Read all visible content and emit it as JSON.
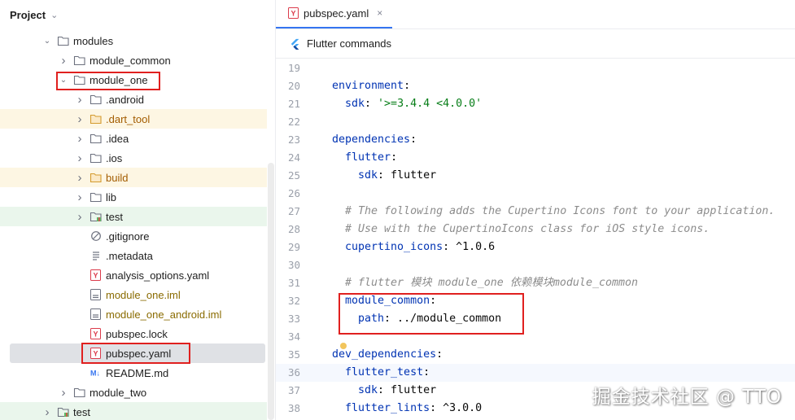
{
  "project": {
    "title": "Project",
    "tree": [
      {
        "label": "modules",
        "type": "folder",
        "expanded": true
      },
      {
        "label": "module_common",
        "type": "folder",
        "expanded": false
      },
      {
        "label": "module_one",
        "type": "folder",
        "expanded": true
      },
      {
        "label": ".android",
        "type": "folder",
        "expanded": false
      },
      {
        "label": ".dart_tool",
        "type": "folder-excluded",
        "expanded": false
      },
      {
        "label": ".idea",
        "type": "folder",
        "expanded": false
      },
      {
        "label": ".ios",
        "type": "folder",
        "expanded": false
      },
      {
        "label": "build",
        "type": "folder-excluded",
        "expanded": false
      },
      {
        "label": "lib",
        "type": "folder",
        "expanded": false
      },
      {
        "label": "test",
        "type": "folder-test",
        "expanded": false
      },
      {
        "label": ".gitignore",
        "type": "ignore-file"
      },
      {
        "label": ".metadata",
        "type": "text-file"
      },
      {
        "label": "analysis_options.yaml",
        "type": "yaml-file"
      },
      {
        "label": "module_one.iml",
        "type": "iml-file"
      },
      {
        "label": "module_one_android.iml",
        "type": "iml-file"
      },
      {
        "label": "pubspec.lock",
        "type": "yaml-file"
      },
      {
        "label": "pubspec.yaml",
        "type": "yaml-file",
        "selected": true
      },
      {
        "label": "README.md",
        "type": "markdown-file"
      },
      {
        "label": "module_two",
        "type": "folder",
        "expanded": false
      },
      {
        "label": "test",
        "type": "folder-test",
        "expanded": false
      }
    ]
  },
  "editor": {
    "tab_label": "pubspec.yaml",
    "tab_close": "×",
    "flutter_commands_label": "Flutter commands",
    "lines": [
      {
        "n": "19",
        "parts": []
      },
      {
        "n": "20",
        "parts": [
          {
            "t": "environment",
            "c": "key"
          },
          {
            "t": ":",
            "c": "plain"
          }
        ]
      },
      {
        "n": "21",
        "parts": [
          {
            "t": "  sdk",
            "c": "key"
          },
          {
            "t": ": ",
            "c": "plain"
          },
          {
            "t": "'>=3.4.4 <4.0.0'",
            "c": "str"
          }
        ]
      },
      {
        "n": "22",
        "parts": []
      },
      {
        "n": "23",
        "parts": [
          {
            "t": "dependencies",
            "c": "key"
          },
          {
            "t": ":",
            "c": "plain"
          }
        ]
      },
      {
        "n": "24",
        "parts": [
          {
            "t": "  flutter",
            "c": "key"
          },
          {
            "t": ":",
            "c": "plain"
          }
        ]
      },
      {
        "n": "25",
        "parts": [
          {
            "t": "    sdk",
            "c": "key"
          },
          {
            "t": ": flutter",
            "c": "plain"
          }
        ]
      },
      {
        "n": "26",
        "parts": []
      },
      {
        "n": "27",
        "parts": [
          {
            "t": "  # The following adds the Cupertino Icons font to your application.",
            "c": "cmt"
          }
        ]
      },
      {
        "n": "28",
        "parts": [
          {
            "t": "  # Use with the CupertinoIcons class for iOS style icons.",
            "c": "cmt"
          }
        ]
      },
      {
        "n": "29",
        "parts": [
          {
            "t": "  cupertino_icons",
            "c": "key"
          },
          {
            "t": ": ^1.0.6",
            "c": "plain"
          }
        ]
      },
      {
        "n": "30",
        "parts": []
      },
      {
        "n": "31",
        "parts": [
          {
            "t": "  # flutter 模块 module_one 依赖模块module_common",
            "c": "cmt"
          }
        ]
      },
      {
        "n": "32",
        "parts": [
          {
            "t": "  module_common",
            "c": "key"
          },
          {
            "t": ":",
            "c": "plain"
          }
        ]
      },
      {
        "n": "33",
        "parts": [
          {
            "t": "    path",
            "c": "key"
          },
          {
            "t": ": ../module_common",
            "c": "plain"
          }
        ]
      },
      {
        "n": "34",
        "parts": []
      },
      {
        "n": "35",
        "parts": [
          {
            "t": "dev_dependencies",
            "c": "key"
          },
          {
            "t": ":",
            "c": "plain"
          }
        ]
      },
      {
        "n": "36",
        "parts": [
          {
            "t": "  flutter_test",
            "c": "key"
          },
          {
            "t": ":",
            "c": "plain"
          }
        ],
        "caret": true
      },
      {
        "n": "37",
        "parts": [
          {
            "t": "    sdk",
            "c": "key"
          },
          {
            "t": ": flutter",
            "c": "plain"
          }
        ]
      },
      {
        "n": "38",
        "parts": [
          {
            "t": "  flutter_lints",
            "c": "key"
          },
          {
            "t": ": ^3.0.0",
            "c": "plain"
          }
        ]
      }
    ]
  },
  "watermark": "掘金技术社区 @ TTO",
  "colors": {
    "highlight_box": "#e0201f",
    "yaml_key": "#0033b3",
    "string": "#067d17",
    "comment": "#8c8c8c",
    "excluded_folder_bg": "#fdf6e3",
    "test_folder_bg": "#eaf6ec",
    "selection_bg": "#dfe1e5"
  }
}
